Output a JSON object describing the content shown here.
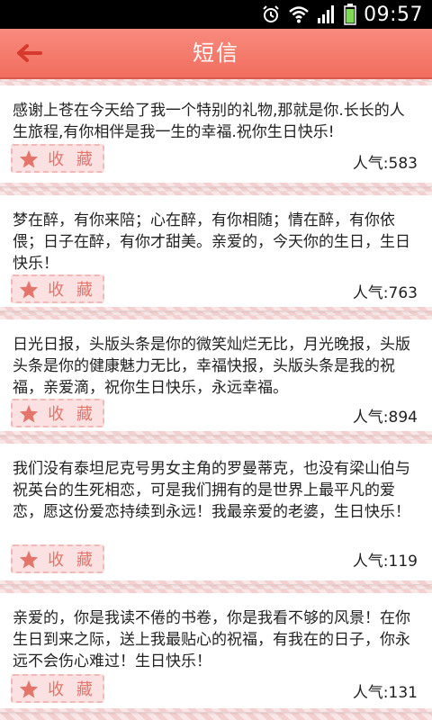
{
  "status": {
    "time": "09:57"
  },
  "header": {
    "title": "短信"
  },
  "colors": {
    "accent": "#f16e5e",
    "favorite": "#e4756a"
  },
  "messages": [
    {
      "text": "感谢上苍在今天给了我一个特别的礼物,那就是你.长长的人生旅程,有你相伴是我一生的幸福.祝你生日快乐!",
      "favorite_label": "收 藏",
      "popularity_label": "人气:",
      "popularity": "583"
    },
    {
      "text": "梦在醉，有你来陪；心在醉，有你相随；情在醉，有你依偎；日子在醉，有你才甜美。亲爱的，今天你的生日，生日快乐！",
      "favorite_label": "收 藏",
      "popularity_label": "人气:",
      "popularity": "763"
    },
    {
      "text": "日光日报，头版头条是你的微笑灿烂无比，月光晚报，头版头条是你的健康魅力无比，幸福快报，头版头条是我的祝福，亲爱滴，祝你生日快乐，永远幸福。",
      "favorite_label": "收 藏",
      "popularity_label": "人气:",
      "popularity": "894"
    },
    {
      "text": "我们没有泰坦尼克号男女主角的罗曼蒂克，也没有梁山伯与祝英台的生死相恋，可是我们拥有的是世界上最平凡的爱恋，愿这份爱恋持续到永远！我最亲爱的老婆，生日快乐！",
      "favorite_label": "收 藏",
      "popularity_label": "人气:",
      "popularity": "119"
    },
    {
      "text": "亲爱的，你是我读不倦的书卷，你是我看不够的风景！在你生日到来之际，送上我最贴心的祝福，有我在的日子，你永远不会伤心难过！生日快乐！",
      "favorite_label": "收 藏",
      "popularity_label": "人气:",
      "popularity": "131"
    }
  ]
}
